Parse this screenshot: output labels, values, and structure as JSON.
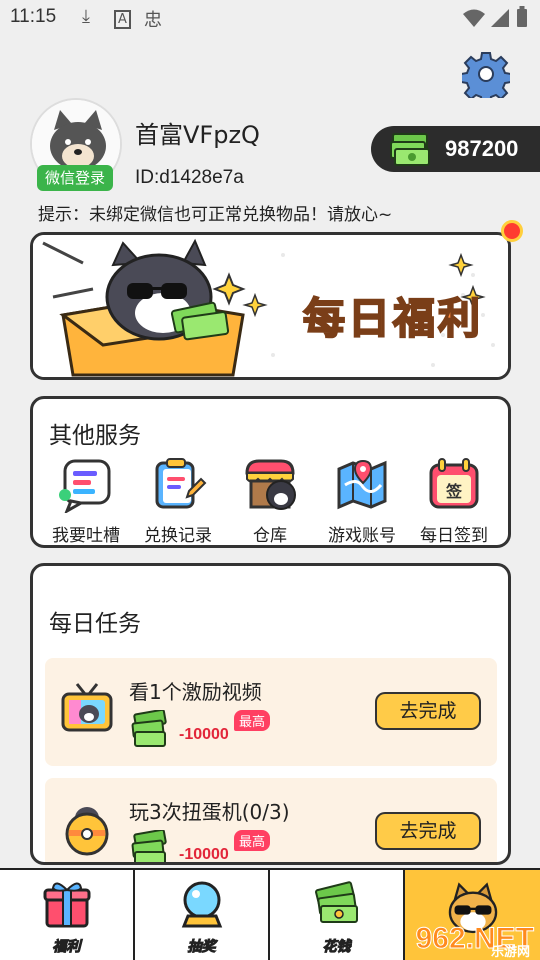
{
  "status_bar": {
    "time": "11:15",
    "icons": [
      "download-icon",
      "font-icon",
      "app-icon",
      "wifi-icon",
      "signal-icon",
      "battery-icon"
    ]
  },
  "settings": {
    "icon": "gear-icon"
  },
  "profile": {
    "nickname": "首富VFpzQ",
    "user_id": "ID:d1428e7a",
    "wechat_badge": "微信登录"
  },
  "coins": {
    "value": "987200",
    "icon": "cash-stack-icon"
  },
  "notice": "提示：未绑定微信也可正常兑换物品！请放心~",
  "banner": {
    "title": "每日福利"
  },
  "services": {
    "title": "其他服务",
    "items": [
      {
        "label": "我要吐槽",
        "icon": "feedback-icon"
      },
      {
        "label": "兑换记录",
        "icon": "clipboard-icon"
      },
      {
        "label": "仓库",
        "icon": "store-icon"
      },
      {
        "label": "游戏账号",
        "icon": "map-icon"
      },
      {
        "label": "每日签到",
        "icon": "calendar-icon"
      }
    ]
  },
  "tasks": {
    "title": "每日任务",
    "items": [
      {
        "name": "看1个激励视频",
        "reward": "-10000",
        "badge": "最高",
        "button": "去完成"
      },
      {
        "name": "玩3次扭蛋机(0/3)",
        "reward": "-10000",
        "badge": "最高",
        "button": "去完成"
      }
    ]
  },
  "tabbar": {
    "tabs": [
      {
        "label": "福利",
        "icon": "gift-icon"
      },
      {
        "label": "抽奖",
        "icon": "crystal-ball-icon"
      },
      {
        "label": "花钱",
        "icon": "cash-icon"
      },
      {
        "label": "",
        "icon": "dog-avatar-icon"
      }
    ]
  },
  "watermark": {
    "text": "962.NET",
    "sub": "乐游网"
  },
  "colors": {
    "accent": "#ffc43a",
    "wechat_green": "#3bb44a",
    "reward_red": "#e2263a",
    "task_bg": "#fdf2e4"
  }
}
